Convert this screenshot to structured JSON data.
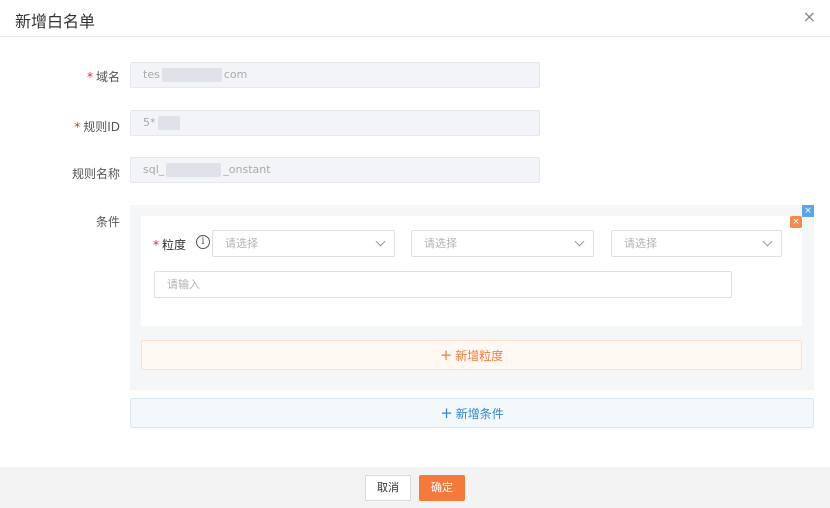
{
  "dialog": {
    "title": "新增白名单",
    "close_glyph": "×"
  },
  "form": {
    "domain": {
      "label": "域名",
      "value_prefix": "tes",
      "value_suffix": "com"
    },
    "rule_id": {
      "label": "规则ID",
      "value_prefix": "5*"
    },
    "rule_name": {
      "label": "规则名称",
      "value_prefix": "sql_",
      "value_suffix": "_onstant"
    },
    "conditions": {
      "label": "条件"
    }
  },
  "condition": {
    "granularity_label": "粒度",
    "info_glyph": "i",
    "select_placeholder": "请选择",
    "input_placeholder": "请输入",
    "add_granularity": "新增粒度",
    "add_condition": "新增条件",
    "plus_glyph": "+",
    "remove_glyph": "×"
  },
  "footer": {
    "cancel": "取消",
    "ok": "确定"
  },
  "icons": [
    "close-icon",
    "info-icon",
    "chevron-down-icon",
    "plus-icon",
    "remove-icon"
  ],
  "colors": {
    "required": "#f5222d",
    "primary": "#f5793b",
    "link_blue": "#2f86d4",
    "orange_text": "#f47d3a"
  }
}
